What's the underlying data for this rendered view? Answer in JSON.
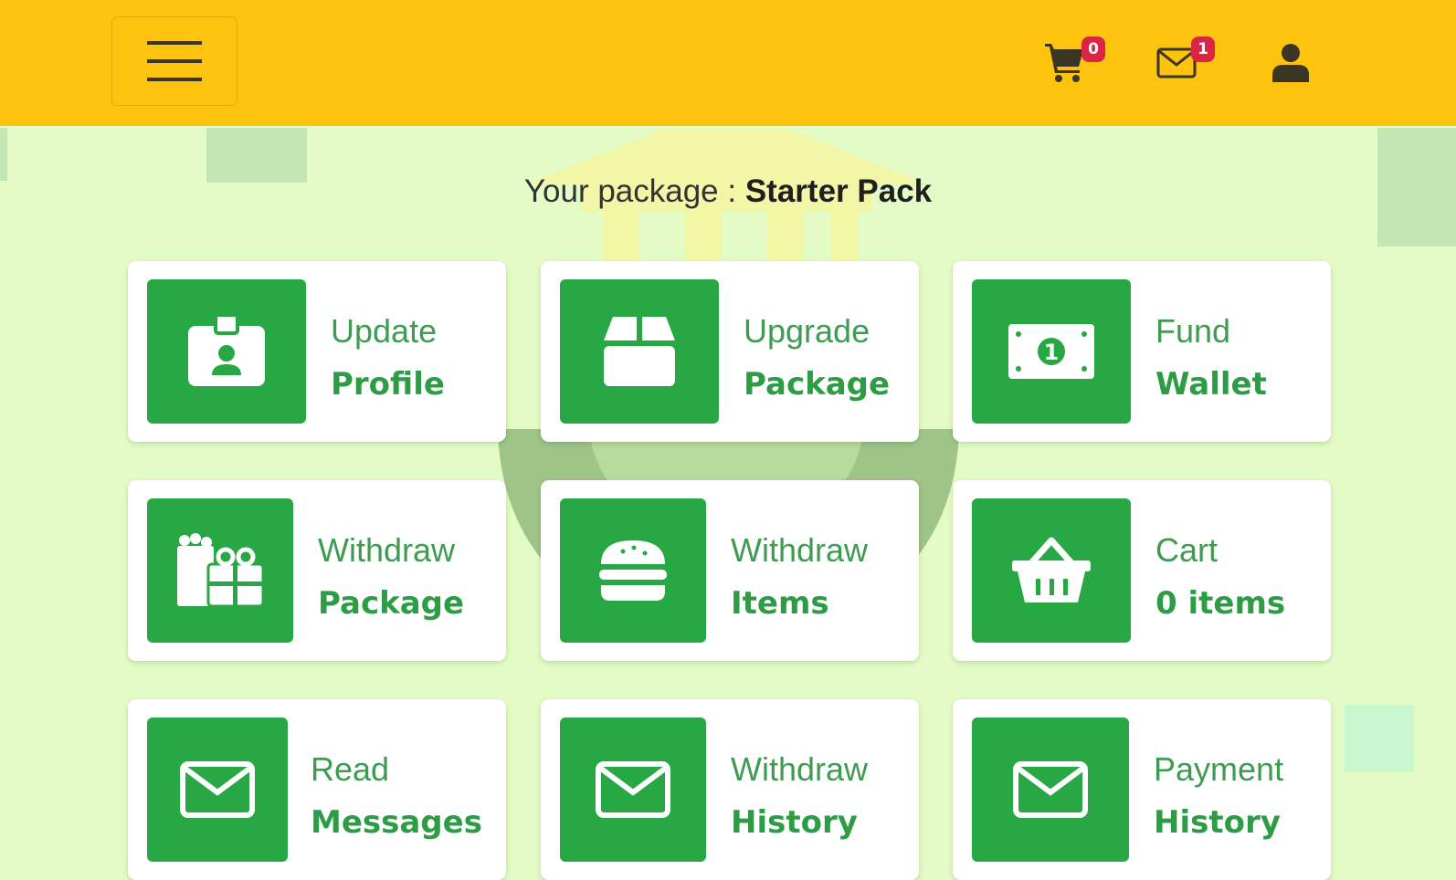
{
  "colors": {
    "header_bg": "#fec30f",
    "page_bg": "#e3fbc4",
    "tile_green": "#28a745",
    "badge_red": "#dc2445"
  },
  "header": {
    "menu_icon": "hamburger-menu-icon",
    "cart": {
      "icon": "shopping-cart-icon",
      "count": "0"
    },
    "messages": {
      "icon": "envelope-icon",
      "count": "1"
    },
    "user_icon": "user-icon"
  },
  "package": {
    "label": "Your package :",
    "name": "Starter Pack"
  },
  "cards": [
    {
      "line1": "Update",
      "line2": "Profile",
      "icon": "id-badge-icon"
    },
    {
      "line1": "Upgrade",
      "line2": "Package",
      "icon": "box-icon"
    },
    {
      "line1": "Fund",
      "line2": "Wallet",
      "icon": "money-bill-icon"
    },
    {
      "line1": "Withdraw",
      "line2": "Package",
      "icon": "gifts-icon"
    },
    {
      "line1": "Withdraw",
      "line2": "Items",
      "icon": "hamburger-food-icon"
    },
    {
      "line1": "Cart",
      "line2": "0 items",
      "icon": "shopping-basket-icon"
    },
    {
      "line1": "Read",
      "line2": "Messages",
      "icon": "envelope-icon"
    },
    {
      "line1": "Withdraw",
      "line2": "History",
      "icon": "envelope-icon"
    },
    {
      "line1": "Payment",
      "line2": "History",
      "icon": "envelope-icon"
    }
  ]
}
